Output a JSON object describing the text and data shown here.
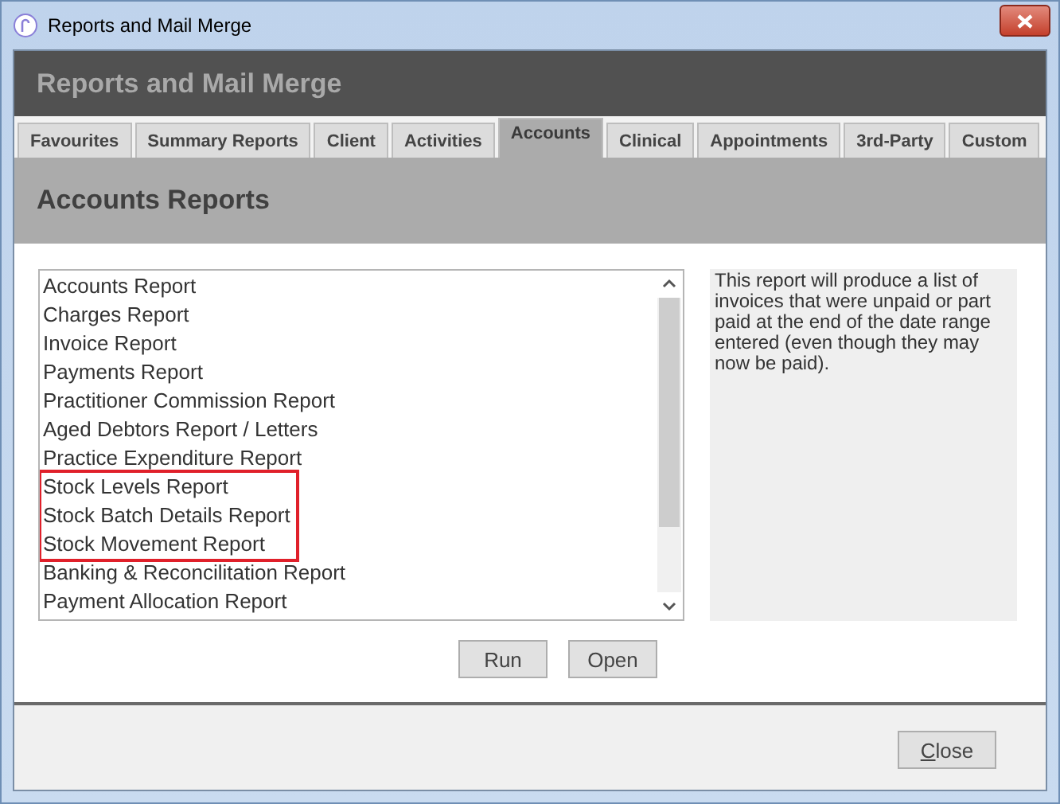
{
  "window": {
    "title": "Reports and Mail Merge"
  },
  "header": {
    "title": "Reports and Mail Merge"
  },
  "tabs": [
    {
      "label": "Favourites",
      "selected": false
    },
    {
      "label": "Summary Reports",
      "selected": false
    },
    {
      "label": "Client",
      "selected": false
    },
    {
      "label": "Activities",
      "selected": false
    },
    {
      "label": "Accounts",
      "selected": true
    },
    {
      "label": "Clinical",
      "selected": false
    },
    {
      "label": "Appointments",
      "selected": false
    },
    {
      "label": "3rd-Party",
      "selected": false
    },
    {
      "label": "Custom",
      "selected": false
    }
  ],
  "section": {
    "title": "Accounts Reports"
  },
  "reports": [
    {
      "label": "Accounts Report",
      "highlighted": false
    },
    {
      "label": "Charges Report",
      "highlighted": false
    },
    {
      "label": "Invoice Report",
      "highlighted": false
    },
    {
      "label": "Payments Report",
      "highlighted": false
    },
    {
      "label": "Practitioner Commission Report",
      "highlighted": false
    },
    {
      "label": "Aged Debtors Report / Letters",
      "highlighted": false
    },
    {
      "label": "Practice Expenditure Report",
      "highlighted": false
    },
    {
      "label": "Stock Levels Report",
      "highlighted": true
    },
    {
      "label": "Stock Batch Details Report",
      "highlighted": true
    },
    {
      "label": "Stock Movement Report",
      "highlighted": true
    },
    {
      "label": "Banking & Reconcilitation Report",
      "highlighted": false
    },
    {
      "label": "Payment Allocation Report",
      "highlighted": false
    }
  ],
  "description": "This report will produce a list of invoices that were unpaid or part paid at the end of the date range entered (even though they may now be paid).",
  "actions": [
    "Run",
    "Open"
  ],
  "footer": {
    "close": "Close"
  }
}
